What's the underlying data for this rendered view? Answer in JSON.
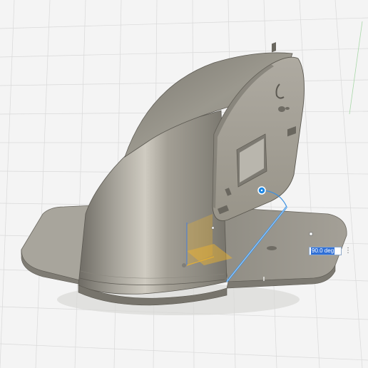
{
  "dimension_input": {
    "value": "90.0 deg",
    "menu_icon": "more-vertical-icon"
  },
  "colors": {
    "background": "#f4f4f4",
    "grid": "#d8d8d8",
    "model_body": "#9c9990",
    "selection_edge": "#3b8fe0",
    "manipulator_handle": "#1e88e5",
    "axis_yellow": "#f0b429",
    "axis_blue": "#4a7fd8"
  }
}
